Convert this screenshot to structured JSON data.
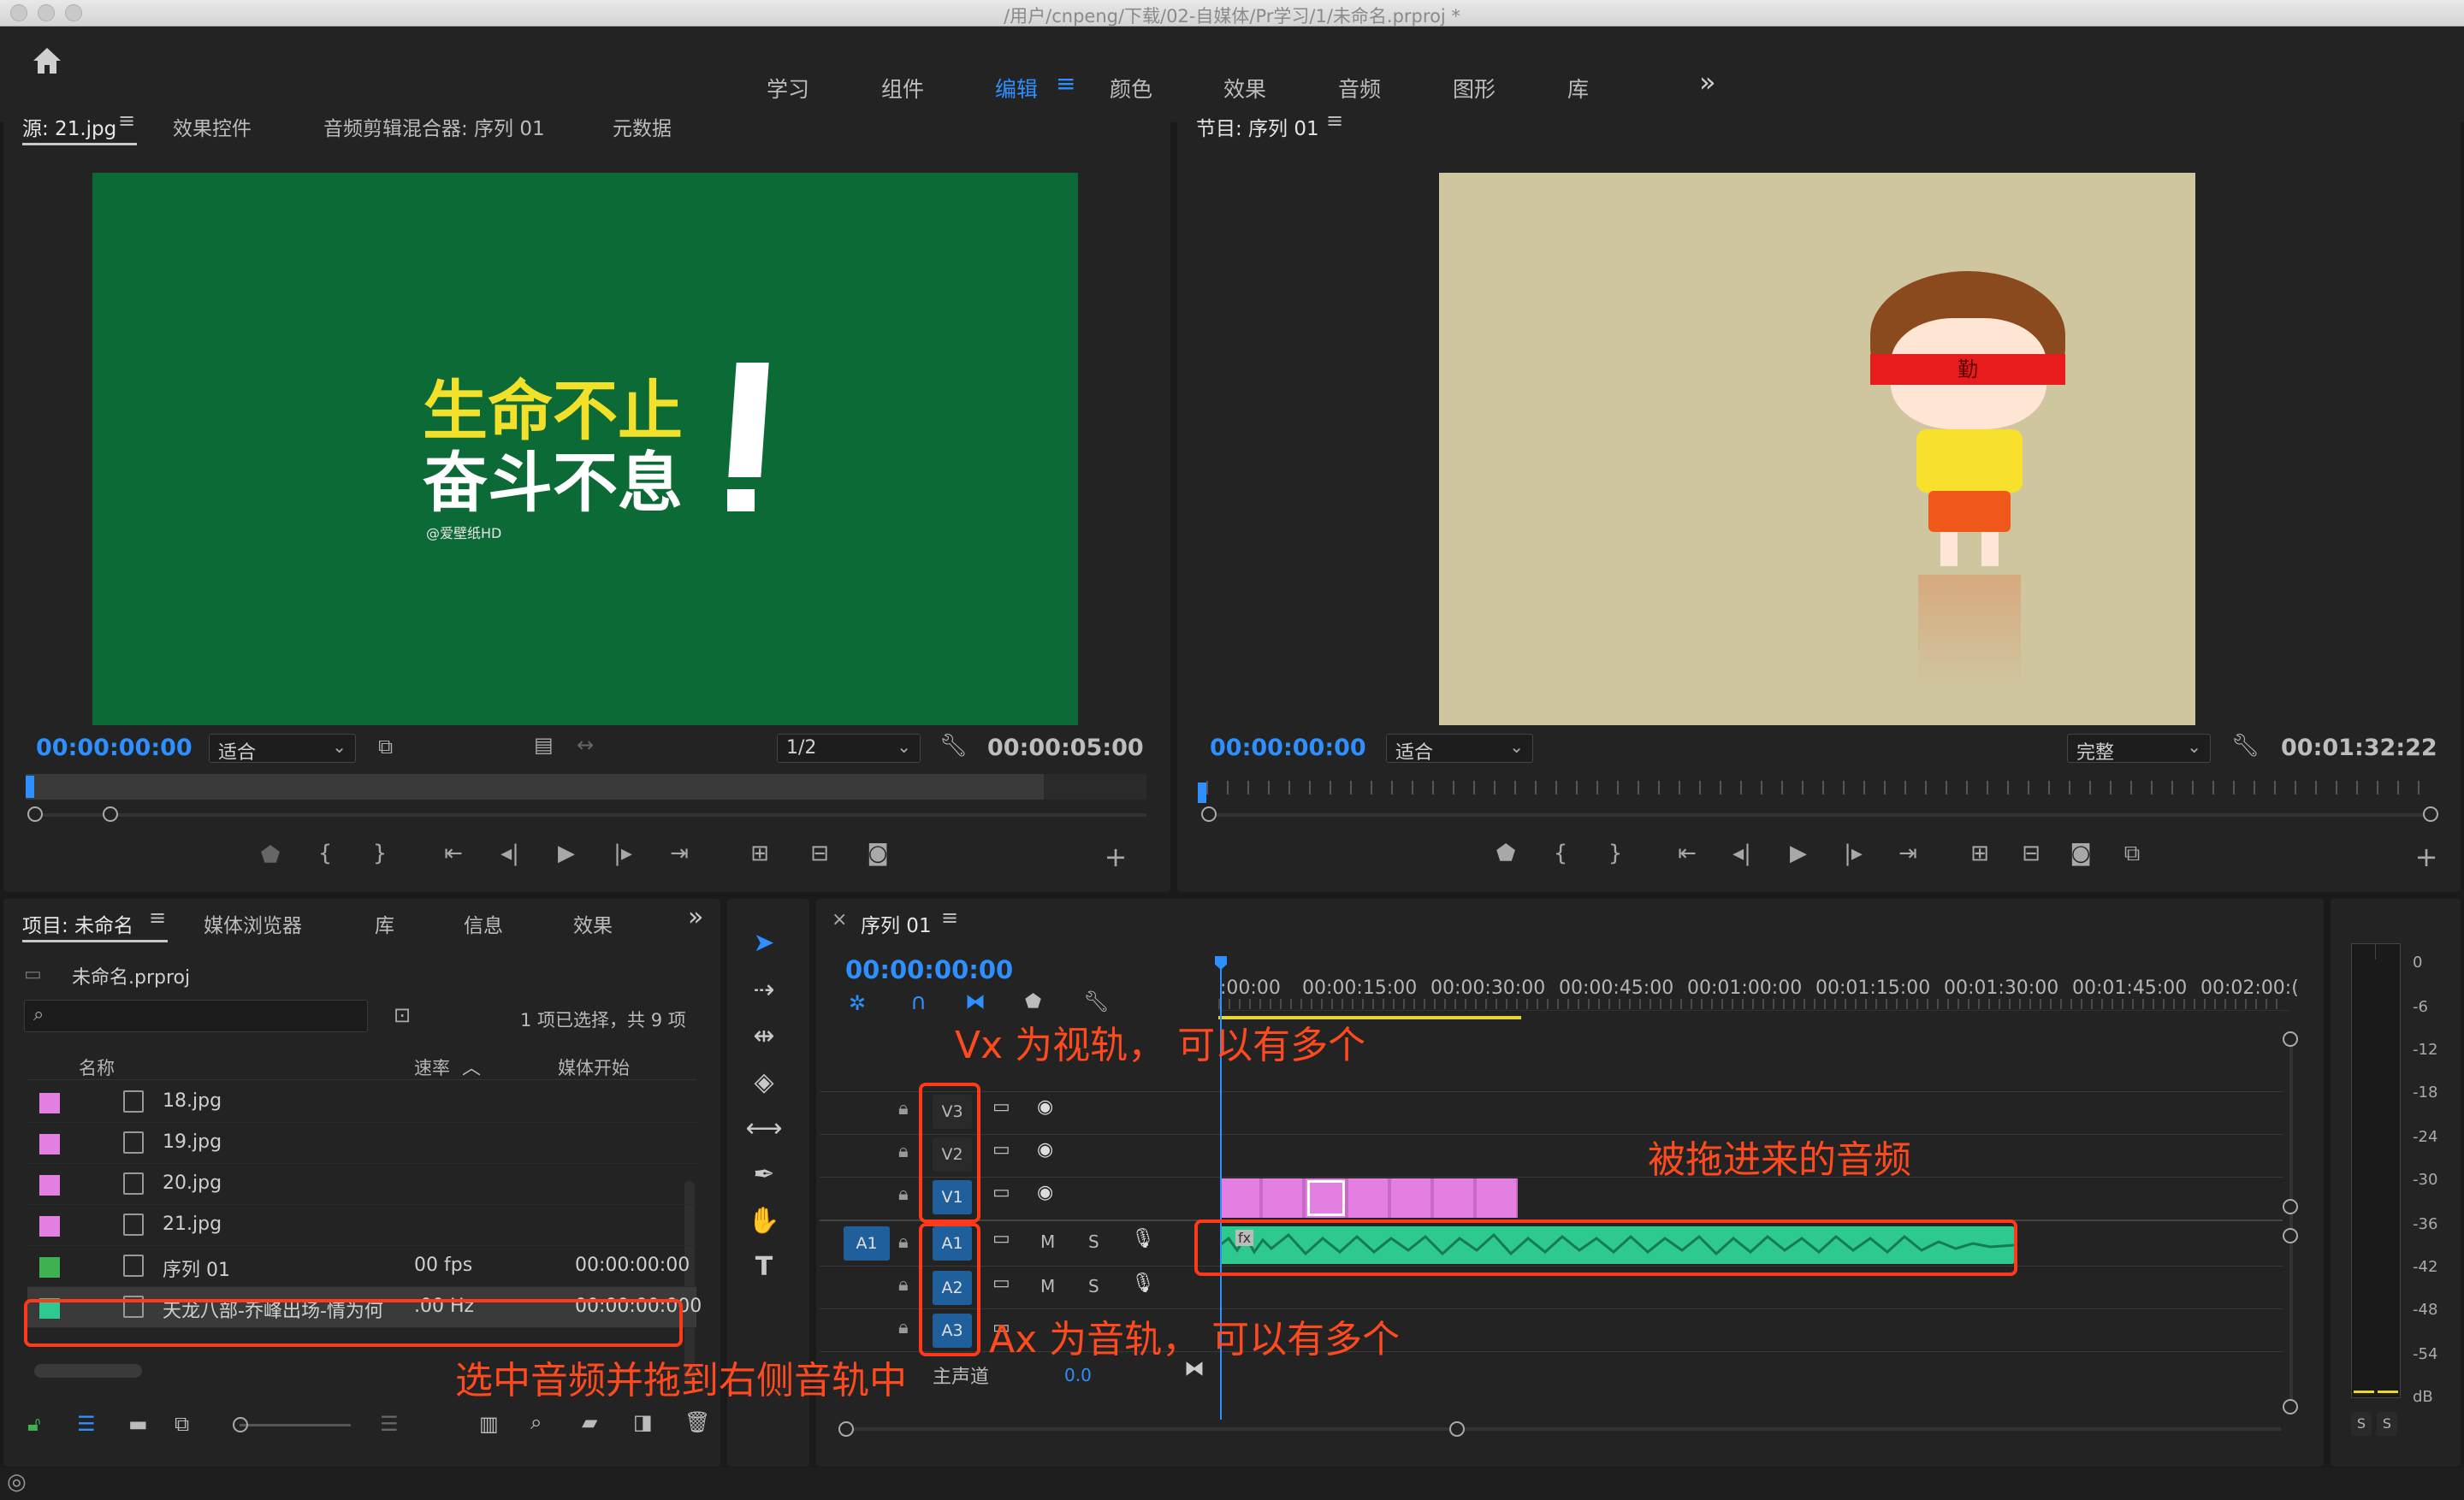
{
  "window": {
    "title": "/用户/cnpeng/下载/02-自媒体/Pr学习/1/未命名.prproj *"
  },
  "workspaces": [
    "学习",
    "组件",
    "编辑",
    "颜色",
    "效果",
    "音频",
    "图形",
    "库"
  ],
  "workspace_active": "编辑",
  "overflow": "»",
  "source_panel": {
    "tabs": [
      "源: 21.jpg",
      "效果控件",
      "音频剪辑混合器: 序列 01",
      "元数据"
    ],
    "image_text_line1": "生命不止",
    "image_text_line2": "奋斗不息",
    "image_watermark": "@爱壁纸HD",
    "timecode": "00:00:00:00",
    "fit": "适合",
    "resolution": "1/2",
    "duration": "00:00:05:00"
  },
  "program_panel": {
    "title": "节目: 序列 01",
    "headband_char": "勤",
    "timecode": "00:00:00:00",
    "fit": "适合",
    "quality": "完整",
    "duration": "00:01:32:22"
  },
  "project_panel": {
    "tabs": [
      "项目: 未命名",
      "媒体浏览器",
      "库",
      "信息",
      "效果"
    ],
    "file": "未命名.prproj",
    "selection_info": "1 项已选择，共 9 项",
    "columns": [
      "名称",
      "速率",
      "媒体开始"
    ],
    "rows": [
      {
        "name": "18.jpg",
        "rate": "",
        "start": "",
        "color": "#e27fe0"
      },
      {
        "name": "19.jpg",
        "rate": "",
        "start": "",
        "color": "#e27fe0"
      },
      {
        "name": "20.jpg",
        "rate": "",
        "start": "",
        "color": "#e27fe0"
      },
      {
        "name": "21.jpg",
        "rate": "",
        "start": "",
        "color": "#e27fe0"
      },
      {
        "name": "序列 01",
        "rate": "00 fps",
        "start": "00:00:00:00",
        "color": "#3fb24f"
      },
      {
        "name": "天龙八部-乔峰出场-情为何",
        "rate": ".00 Hz",
        "start": "00:00:00:000",
        "color": "#2ec98f"
      }
    ]
  },
  "timeline": {
    "tab": "序列 01",
    "timecode": "00:00:00:00",
    "ticks": [
      ":00:00",
      "00:00:15:00",
      "00:00:30:00",
      "00:00:45:00",
      "00:01:00:00",
      "00:01:15:00",
      "00:01:30:00",
      "00:01:45:00",
      "00:02:00:("
    ],
    "video_tracks": [
      "V3",
      "V2",
      "V1"
    ],
    "audio_tracks": [
      "A1",
      "A2",
      "A3"
    ],
    "source_patch": "A1",
    "m": "M",
    "s": "S",
    "master_label": "主声道",
    "master_value": "0.0",
    "fx": "fx"
  },
  "meter": {
    "labels": [
      "0",
      "-6",
      "-12",
      "-18",
      "-24",
      "-30",
      "-36",
      "-42",
      "-48",
      "-54",
      "dB"
    ],
    "solo": [
      "S",
      "S"
    ]
  },
  "annotations": {
    "video": "Vx 为视轨， 可以有多个",
    "audio_clip": "被拖进来的音频",
    "audio": "Ax 为音轨， 可以有多个",
    "drag": "选中音频并拖到右侧音轨中"
  },
  "colors": {
    "accent": "#2e8fff",
    "annotation": "#ff3a1a",
    "video_clip": "#e27fe0",
    "audio_clip": "#2ec98f"
  }
}
